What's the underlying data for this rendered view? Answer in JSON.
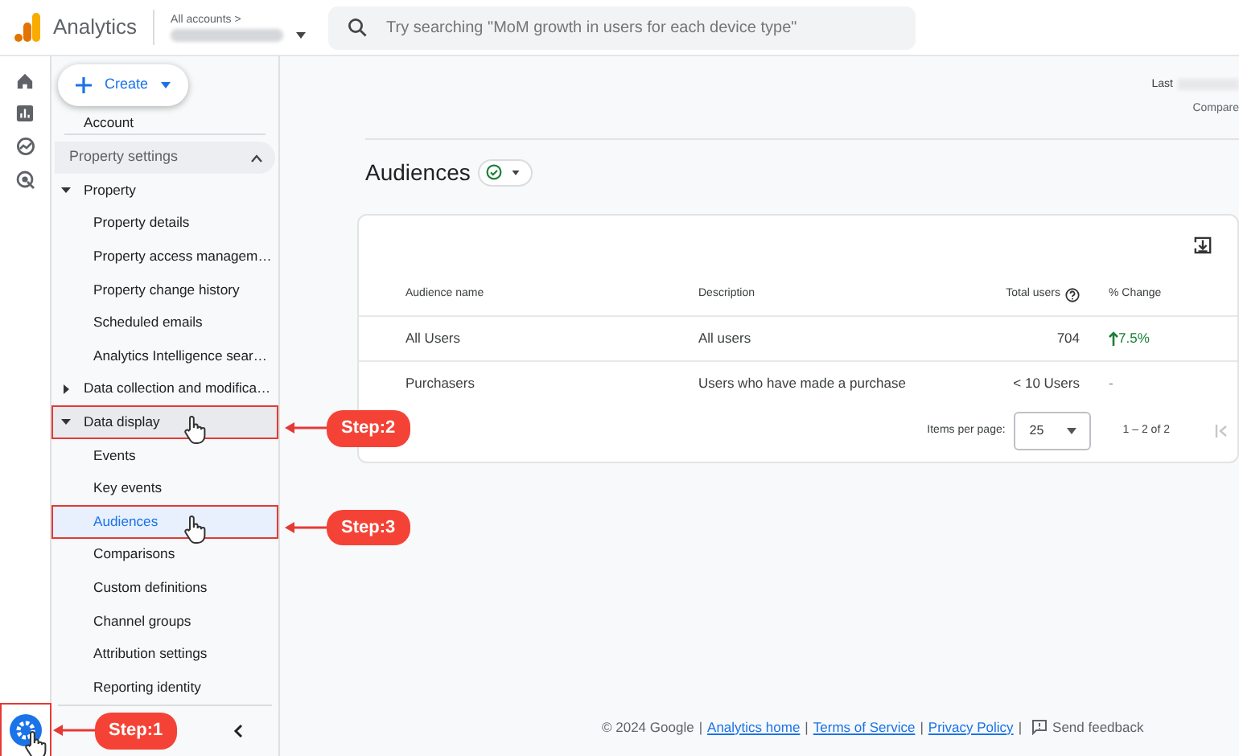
{
  "header": {
    "product": "Analytics",
    "breadcrumb": "All accounts >",
    "search": {
      "placeholder": "Try searching \"MoM growth in users for each device type\""
    }
  },
  "rail": {
    "settings": {
      "selected": true,
      "annotation": "Step:1"
    }
  },
  "create_button": {
    "label": "Create"
  },
  "sidebar": {
    "account": "Account",
    "section": {
      "label": "Property settings",
      "expanded": true
    },
    "items": [
      {
        "label": "Property",
        "expanded": true,
        "selected": false,
        "children": [
          {
            "label": "Property details",
            "selected": false
          },
          {
            "label": "Property access managem…",
            "selected": false
          },
          {
            "label": "Property change history",
            "selected": false
          },
          {
            "label": "Scheduled emails",
            "selected": false
          },
          {
            "label": "Analytics Intelligence sear…",
            "selected": false
          }
        ]
      },
      {
        "label": "Data collection and modifica…",
        "expanded": false,
        "selected": false
      },
      {
        "label": "Data display",
        "expanded": true,
        "selected": true,
        "annotation": "Step:2",
        "children": [
          {
            "label": "Events",
            "selected": false
          },
          {
            "label": "Key events",
            "selected": false
          },
          {
            "label": "Audiences",
            "selected": true,
            "annotation": "Step:3"
          },
          {
            "label": "Comparisons",
            "selected": false
          },
          {
            "label": "Custom definitions",
            "selected": false
          },
          {
            "label": "Channel groups",
            "selected": false
          },
          {
            "label": "Attribution settings",
            "selected": false
          },
          {
            "label": "Reporting identity",
            "selected": false
          }
        ]
      }
    ]
  },
  "date_range": {
    "label": "Last",
    "compare": "Compare"
  },
  "page_title": "Audiences",
  "table": {
    "columns": [
      "Audience name",
      "Description",
      "Total users",
      "% Change"
    ],
    "rows": [
      {
        "name": "All Users",
        "description": "All users",
        "total_users": "704",
        "change": "7.5%",
        "trend_up": true
      },
      {
        "name": "Purchasers",
        "description": "Users who have made a purchase",
        "total_users": "< 10 Users",
        "change": "-",
        "trend_up": false
      }
    ]
  },
  "pagination": {
    "items_per_page_label": "Items per page:",
    "items_per_page": "25",
    "range": "1 – 2 of 2"
  },
  "footer": {
    "parts": [
      {
        "kind": "text",
        "text": "© 2024 Google"
      },
      {
        "kind": "separator",
        "text": "|"
      },
      {
        "kind": "link",
        "text": "Analytics home"
      },
      {
        "kind": "separator",
        "text": "|"
      },
      {
        "kind": "link",
        "text": "Terms of Service"
      },
      {
        "kind": "separator",
        "text": "|"
      },
      {
        "kind": "link",
        "text": "Privacy Policy"
      },
      {
        "kind": "separator",
        "text": "|"
      }
    ],
    "feedback": "Send feedback"
  }
}
